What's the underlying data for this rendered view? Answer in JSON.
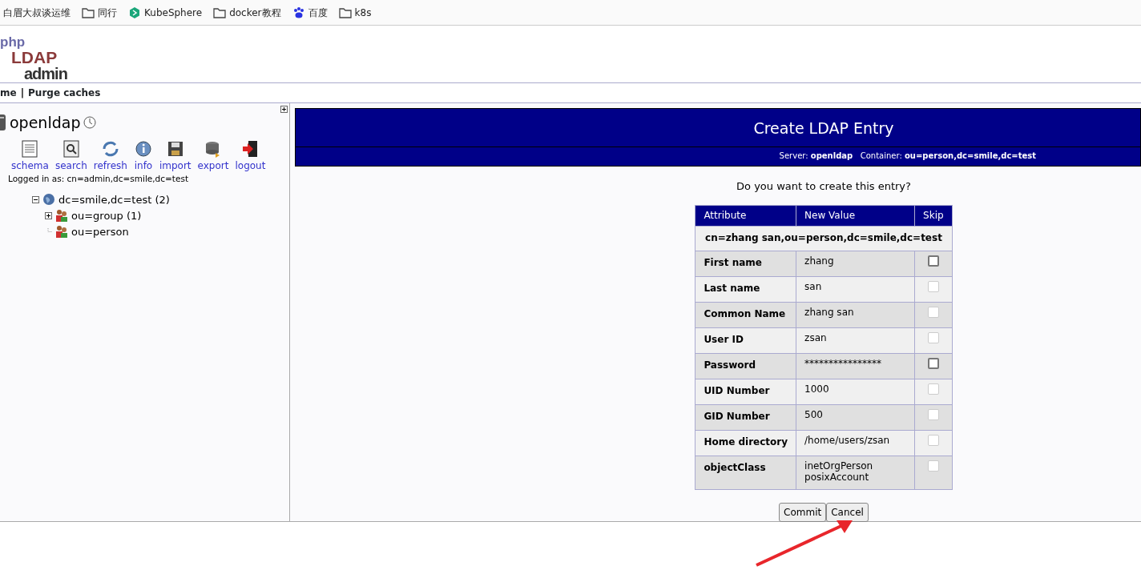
{
  "bookmarks": [
    {
      "label": "白眉大叔谈运维",
      "kind": "plain"
    },
    {
      "label": "同行",
      "kind": "folder"
    },
    {
      "label": "KubeSphere",
      "kind": "cube"
    },
    {
      "label": "docker教程",
      "kind": "folder"
    },
    {
      "label": "百度",
      "kind": "paw"
    },
    {
      "label": "k8s",
      "kind": "folder"
    }
  ],
  "logo": {
    "line_1": "php",
    "line_2": "LDAP",
    "line_3": "admin"
  },
  "menu": {
    "items": [
      "me",
      "Purge caches"
    ],
    "separator": "|"
  },
  "server": {
    "name": "openldap",
    "toolbar": [
      "schema",
      "search",
      "refresh",
      "info",
      "import",
      "export",
      "logout"
    ],
    "logged_in": "Logged in as: cn=admin,dc=smile,dc=test",
    "tree": [
      {
        "label": "dc=smile,dc=test (2)",
        "kind": "globe",
        "expanded": true,
        "children": [
          {
            "label": "ou=group (1)",
            "kind": "people",
            "expanded": false
          },
          {
            "label": "ou=person",
            "kind": "people"
          }
        ]
      }
    ]
  },
  "page": {
    "title": "Create LDAP Entry",
    "server_label": "Server:",
    "server": "openldap",
    "container_label": "Container:",
    "container": "ou=person,dc=smile,dc=test",
    "question": "Do you want to create this entry?"
  },
  "table": {
    "columns": [
      "Attribute",
      "New Value",
      "Skip"
    ],
    "dn": "cn=zhang san,ou=person,dc=smile,dc=test",
    "rows": [
      {
        "attribute": "First name",
        "values": [
          "zhang"
        ],
        "checked": false,
        "disabled": false
      },
      {
        "attribute": "Last name",
        "values": [
          "san"
        ],
        "checked": false,
        "disabled": true
      },
      {
        "attribute": "Common Name",
        "values": [
          "zhang san"
        ],
        "checked": false,
        "disabled": true
      },
      {
        "attribute": "User ID",
        "values": [
          "zsan"
        ],
        "checked": false,
        "disabled": true
      },
      {
        "attribute": "Password",
        "values": [
          "****************"
        ],
        "checked": false,
        "disabled": false
      },
      {
        "attribute": "UID Number",
        "values": [
          "1000"
        ],
        "checked": false,
        "disabled": true
      },
      {
        "attribute": "GID Number",
        "values": [
          "500"
        ],
        "checked": false,
        "disabled": true
      },
      {
        "attribute": "Home directory",
        "values": [
          "/home/users/zsan"
        ],
        "checked": false,
        "disabled": true
      },
      {
        "attribute": "objectClass",
        "values": [
          "inetOrgPerson",
          "posixAccount"
        ],
        "checked": false,
        "disabled": true
      }
    ]
  },
  "buttons": [
    "Commit",
    "Cancel"
  ]
}
